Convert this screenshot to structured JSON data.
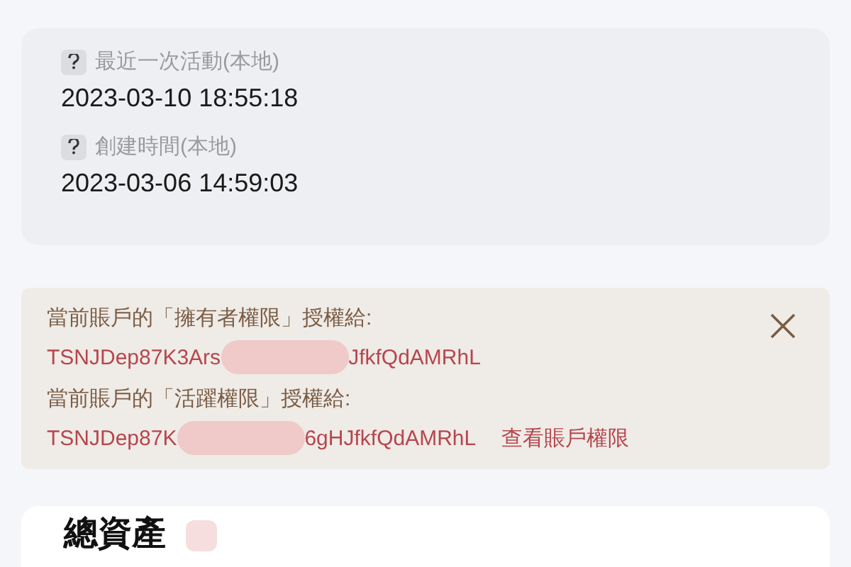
{
  "activity_card": {
    "fields": [
      {
        "label": "最近一次活動(本地)",
        "value": "2023-03-10 18:55:18"
      },
      {
        "label": "創建時間(本地)",
        "value": "2023-03-06 14:59:03"
      }
    ]
  },
  "permission_notice": {
    "grants": [
      {
        "text": "當前賬戶的「擁有者權限」授權給:",
        "address_start": "TSNJDep87K3Ars",
        "address_end": "JfkfQdAMRhL"
      },
      {
        "text": "當前賬戶的「活躍權限」授權給:",
        "address_start": "TSNJDep87K",
        "address_end": "6gHJfkfQdAMRhL",
        "link": "查看賬戶權限"
      }
    ]
  },
  "assets_card": {
    "title": "總資產"
  }
}
